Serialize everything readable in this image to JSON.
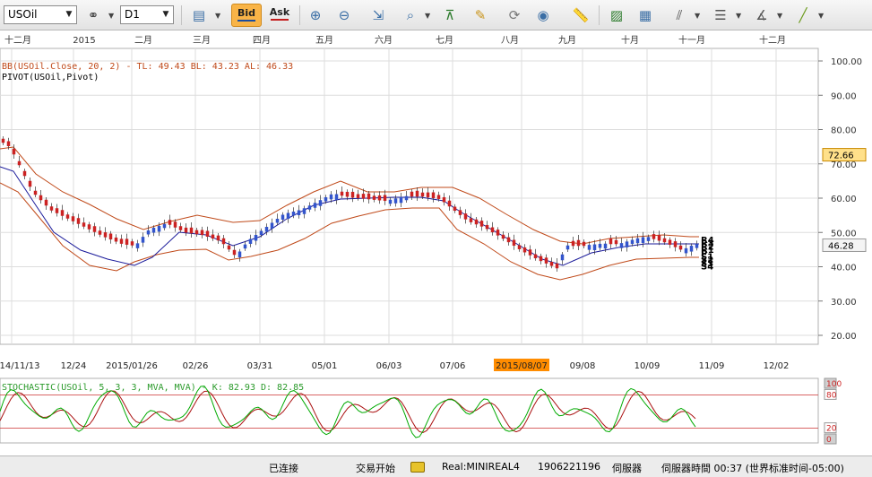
{
  "toolbar": {
    "symbol": "USOil",
    "timeframe": "D1",
    "bid_label": "Bid",
    "ask_label": "Ask"
  },
  "indicator_labels": {
    "bb_text": "BB(USOil.Close, 20, 2) - TL: 49.43  BL: 43.23  AL: 46.33",
    "pivot_text": "PIVOT(USOil,Pivot)",
    "stoch_text": "STOCHASTIC(USOil, 5, 3, 3, MVA, MVA) - K: 82.93  D: 82.85"
  },
  "statusbar": {
    "connection": "已连接",
    "trading": "交易开始",
    "account": "Real:MINIREAL4",
    "account_id": "1906221196",
    "server": "伺服器",
    "server_time": "伺服器時間 00:37 (世界标准时间-05:00)"
  },
  "colors": {
    "bull": "#3355cc",
    "bear": "#cc2222",
    "bands": "#c04a1a",
    "ma": "#1a1a9a",
    "k_line": "#00aa00",
    "d_line": "#aa1111",
    "highlight": "#ff8c00"
  },
  "chart_data": [
    {
      "type": "candlestick",
      "symbol": "USOil",
      "ylim": [
        17,
        104
      ],
      "y_ticks": [
        "100.00",
        "90.00",
        "80.00",
        "70.00",
        "60.00",
        "50.00",
        "40.00",
        "30.00",
        "20.00"
      ],
      "month_labels": [
        "十二月",
        "2015",
        "二月",
        "三月",
        "四月",
        "五月",
        "六月",
        "七月",
        "八月",
        "九月",
        "十月",
        "十一月",
        "十二月"
      ],
      "date_labels": [
        "14/11/13",
        "12/24",
        "2015/01/26",
        "02/26",
        "03/31",
        "05/01",
        "06/03",
        "07/06",
        "2015/08/07",
        "09/08",
        "10/09",
        "11/09",
        "12/02"
      ],
      "highlighted_date": "2015/08/07",
      "price_marks": [
        {
          "label": "72.66",
          "value": 72.66,
          "highlight": true
        },
        {
          "label": "46.28",
          "value": 46.28,
          "highlight": false
        }
      ],
      "pivot_labels": [
        "R4",
        "R3",
        "R2",
        "R1",
        "P",
        "S1",
        "S2",
        "S3",
        "S4"
      ],
      "bollinger": {
        "period": 20,
        "deviations": 2,
        "TL": 49.43,
        "BL": 43.23,
        "AL": 46.33
      },
      "series": [
        {
          "name": "Close",
          "x": [
            "2014-11-13",
            "2014-12-24",
            "2015-01-26",
            "2015-02-26",
            "2015-03-31",
            "2015-05-01",
            "2015-06-03",
            "2015-07-06",
            "2015-08-07",
            "2015-09-08",
            "2015-10-09",
            "2015-11-09"
          ],
          "values": [
            78,
            57,
            47,
            51,
            44,
            59,
            60,
            55,
            45,
            46,
            49,
            46.3
          ]
        }
      ]
    },
    {
      "type": "line",
      "indicator": "Stochastic",
      "params": [
        5,
        3,
        3
      ],
      "K": 82.93,
      "D": 82.85,
      "ylim": [
        0,
        100
      ],
      "y_ticks": [
        "100",
        "80",
        "20",
        "0"
      ]
    }
  ]
}
